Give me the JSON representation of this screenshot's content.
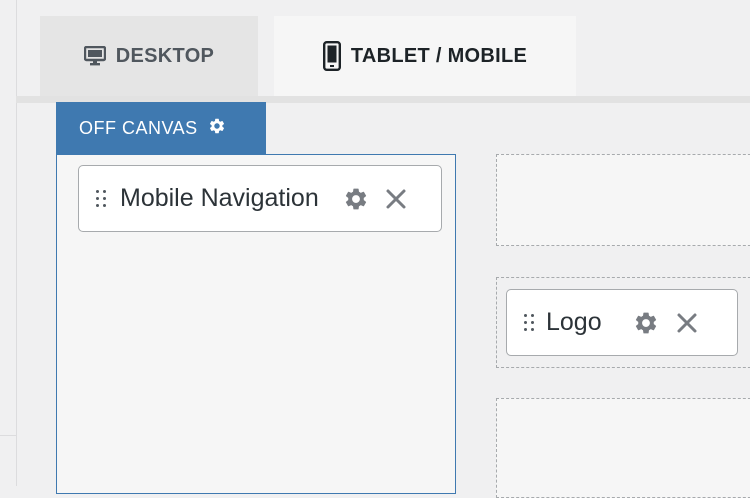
{
  "tabs": [
    {
      "label": "DESKTOP",
      "icon": "desktop-icon",
      "active": false
    },
    {
      "label": "TABLET / MOBILE",
      "icon": "mobile-icon",
      "active": true
    }
  ],
  "off_canvas": {
    "label": "OFF CANVAS",
    "icon": "gear-icon"
  },
  "widgets": {
    "mobile_navigation": {
      "label": "Mobile Navigation"
    },
    "logo": {
      "label": "Logo"
    }
  },
  "colors": {
    "accent": "#3f79b0",
    "text_dark": "#1d2327",
    "icon_gray": "#787c82"
  }
}
